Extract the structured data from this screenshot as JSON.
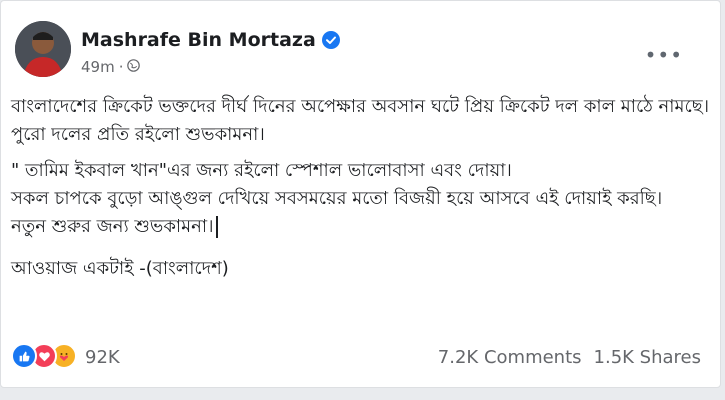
{
  "post": {
    "author": "Mashrafe Bin Mortaza",
    "time": "49m",
    "paragraphs": [
      "বাংলাদেশের ক্রিকেট ভক্তদের দীর্ঘ দিনের অপেক্ষার অবসান ঘটে প্রিয় ক্রিকেট দল কাল মাঠে নামছে।পুরো দলের প্রতি রইলো শুভকামনা।",
      "\" তামিম ইকবাল খান\"এর  জন্য রইলো স্পেশাল ভালোবাসা এবং দোয়া।\nসকল চাপকে বুড়ো আঙ্গুল দেখিয়ে সবসময়ের মতো বিজয়ী হয়ে আসবে এই দোয়াই করছি।\nনতুন শুরুর জন্য শুভকামনা।",
      "আওয়াজ একটাই -(বাংলাদেশ)"
    ],
    "reactions_count": "92K",
    "comments": "7.2K Comments",
    "shares": "1.5K Shares"
  },
  "colors": {
    "accent": "#1877f2",
    "like": "#1877f2",
    "love": "#f33e58",
    "care": "#f7b125"
  }
}
